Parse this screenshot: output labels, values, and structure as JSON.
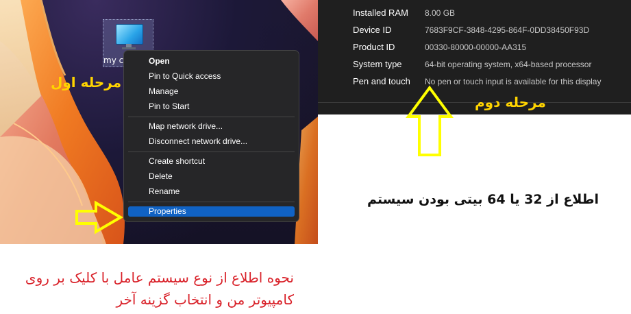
{
  "desktop": {
    "icon_label": "my co",
    "step_label": "مرحله اول"
  },
  "context_menu": {
    "items": [
      {
        "label": "Open",
        "bold": true
      },
      {
        "label": "Pin to Quick access"
      },
      {
        "label": "Manage"
      },
      {
        "label": "Pin to Start"
      },
      {
        "label": "Map network drive..."
      },
      {
        "label": "Disconnect network drive..."
      },
      {
        "label": "Create shortcut"
      },
      {
        "label": "Delete"
      },
      {
        "label": "Rename"
      },
      {
        "label": "Properties",
        "selected": true
      }
    ]
  },
  "system_panel": {
    "rows": [
      {
        "label": "Installed RAM",
        "value": "8.00 GB"
      },
      {
        "label": "Device ID",
        "value": "7683F9CF-3848-4295-864F-0DD38450F93D"
      },
      {
        "label": "Product ID",
        "value": "00330-80000-00000-AA315"
      },
      {
        "label": "System type",
        "value": "64-bit operating system, x64-based processor"
      },
      {
        "label": "Pen and touch",
        "value": "No pen or touch input is available for this display"
      }
    ],
    "step_label": "مرحله دوم"
  },
  "captions": {
    "bitness": "اطلاع از 32 یا 64 بیتی بودن سیستم",
    "howto_line1": "نحوه اطلاع از نوع سیستم عامل با کلیک بر روی",
    "howto_line2": "کامپیوتر من و انتخاب گزینه آخر"
  },
  "colors": {
    "arrow": "#ffff00",
    "accent_blue": "#1062c4",
    "caption_red": "#d9222a",
    "step_yellow": "#ffd400"
  }
}
